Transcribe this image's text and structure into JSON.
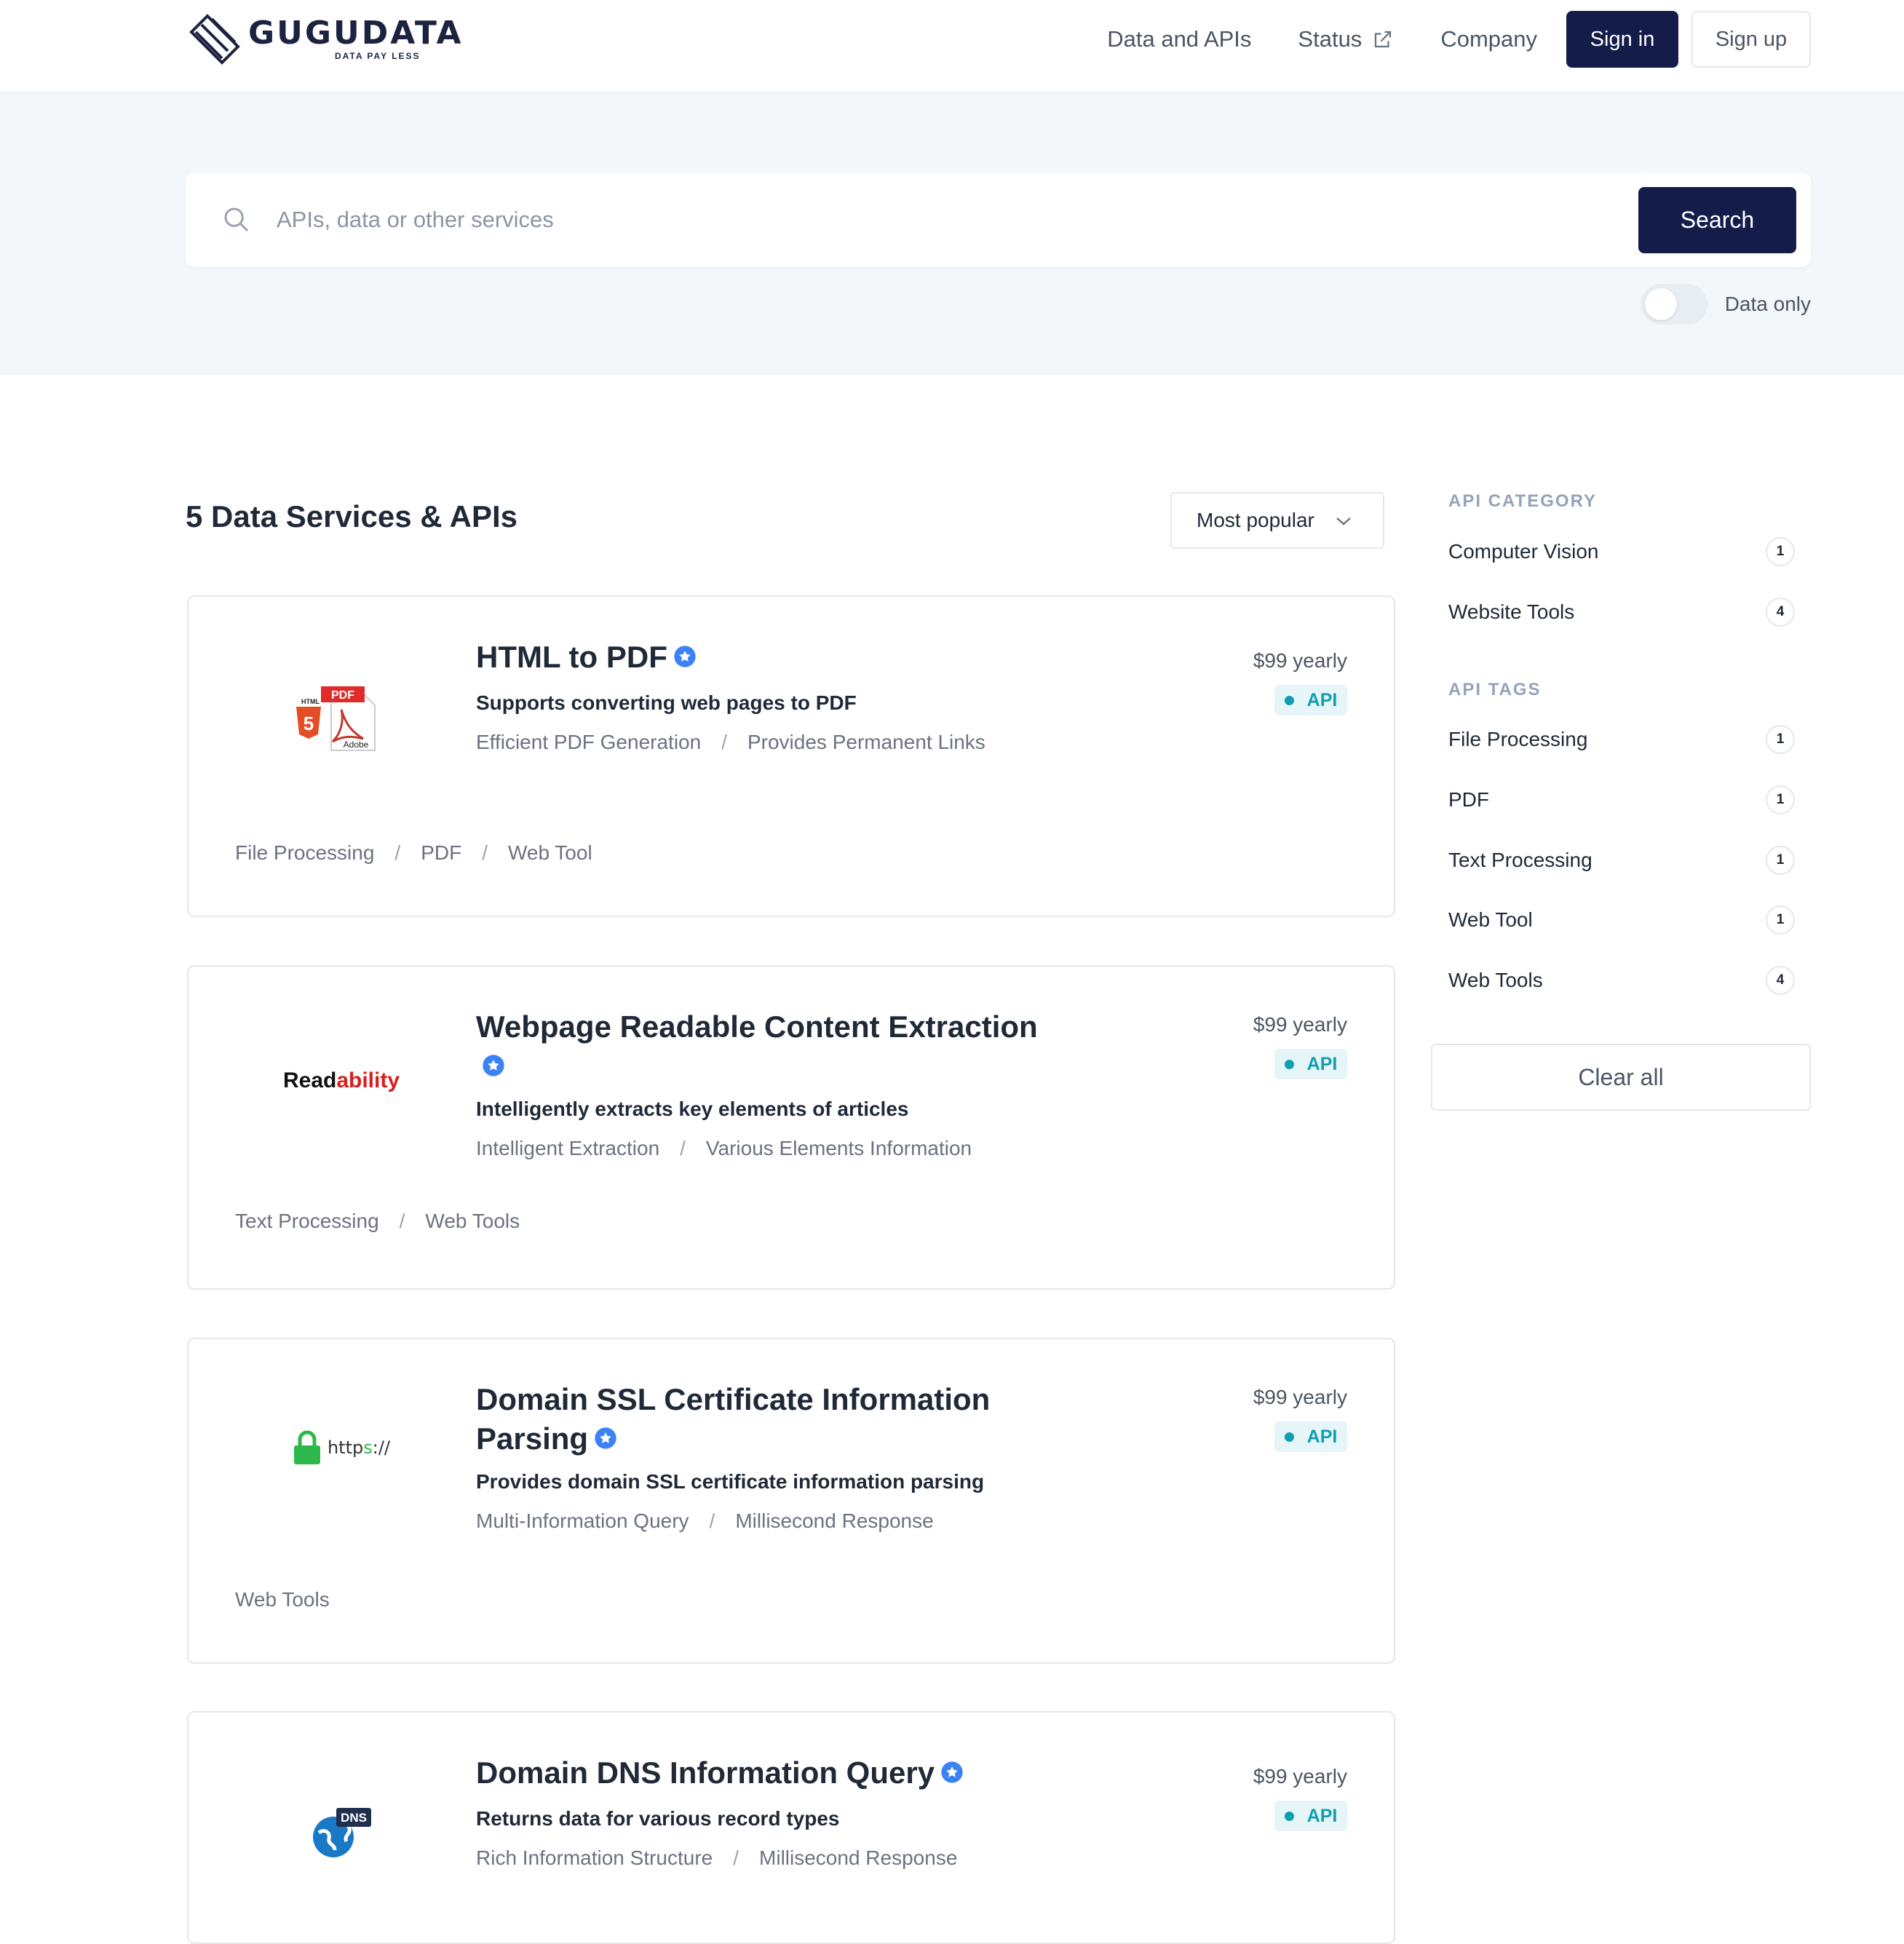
{
  "header": {
    "logo_text": "GUGUDATA",
    "logo_tagline": "DATA PAY LESS",
    "nav": [
      {
        "label": "Data and APIs"
      },
      {
        "label": "Status"
      },
      {
        "label": "Company"
      }
    ],
    "signin_label": "Sign in",
    "signup_label": "Sign up"
  },
  "search": {
    "placeholder": "APIs, data or other services",
    "value": "",
    "button_label": "Search",
    "toggle_label": "Data only",
    "toggle_on": false
  },
  "results": {
    "title": "5 Data Services & APIs",
    "sort_selected": "Most popular",
    "cards": [
      {
        "title": "HTML to PDF",
        "subtitle": "Supports converting web pages to PDF",
        "features": [
          "Efficient PDF Generation",
          "Provides Permanent Links"
        ],
        "price": "$99 yearly",
        "badge": "API",
        "tags": [
          "File Processing",
          "PDF",
          "Web Tool"
        ],
        "logo": "html-pdf-icon",
        "logo_texts": {
          "pdf": "PDF",
          "html": "HTML",
          "adobe": "Adobe"
        }
      },
      {
        "title": "Webpage Readable Content Extraction",
        "subtitle": "Intelligently extracts key elements of articles",
        "features": [
          "Intelligent Extraction",
          "Various Elements Information"
        ],
        "price": "$99 yearly",
        "badge": "API",
        "tags": [
          "Text Processing",
          "Web Tools"
        ],
        "logo": "readability-logo",
        "logo_texts": {
          "part1": "Read",
          "part2": "ability"
        }
      },
      {
        "title": "Domain SSL Certificate Information Parsing",
        "subtitle": "Provides domain SSL certificate information parsing",
        "features": [
          "Multi-Information Query",
          "Millisecond Response"
        ],
        "price": "$99 yearly",
        "badge": "API",
        "tags": [
          "Web Tools"
        ],
        "logo": "ssl-lock-icon",
        "logo_texts": {
          "https_a": "http",
          "https_s": "s",
          "https_b": "://"
        }
      },
      {
        "title": "Domain DNS Information Query",
        "subtitle": "Returns data for various record types",
        "features": [
          "Rich Information Structure",
          "Millisecond Response"
        ],
        "price": "$99 yearly",
        "badge": "API",
        "tags": [],
        "logo": "dns-globe-icon",
        "logo_texts": {
          "dns": "DNS"
        }
      }
    ]
  },
  "sidebar": {
    "category_heading": "API CATEGORY",
    "categories": [
      {
        "label": "Computer Vision",
        "count": "1"
      },
      {
        "label": "Website Tools",
        "count": "4"
      }
    ],
    "tags_heading": "API TAGS",
    "tags": [
      {
        "label": "File Processing",
        "count": "1"
      },
      {
        "label": "PDF",
        "count": "1"
      },
      {
        "label": "Text Processing",
        "count": "1"
      },
      {
        "label": "Web Tool",
        "count": "1"
      },
      {
        "label": "Web Tools",
        "count": "4"
      }
    ],
    "clear_label": "Clear all"
  },
  "colors": {
    "primary": "#141d4a",
    "badge_text": "#0e9fb1",
    "badge_bg": "#e6f6f8",
    "verified": "#3b82f6",
    "hero_bg": "#f3f7fa"
  }
}
